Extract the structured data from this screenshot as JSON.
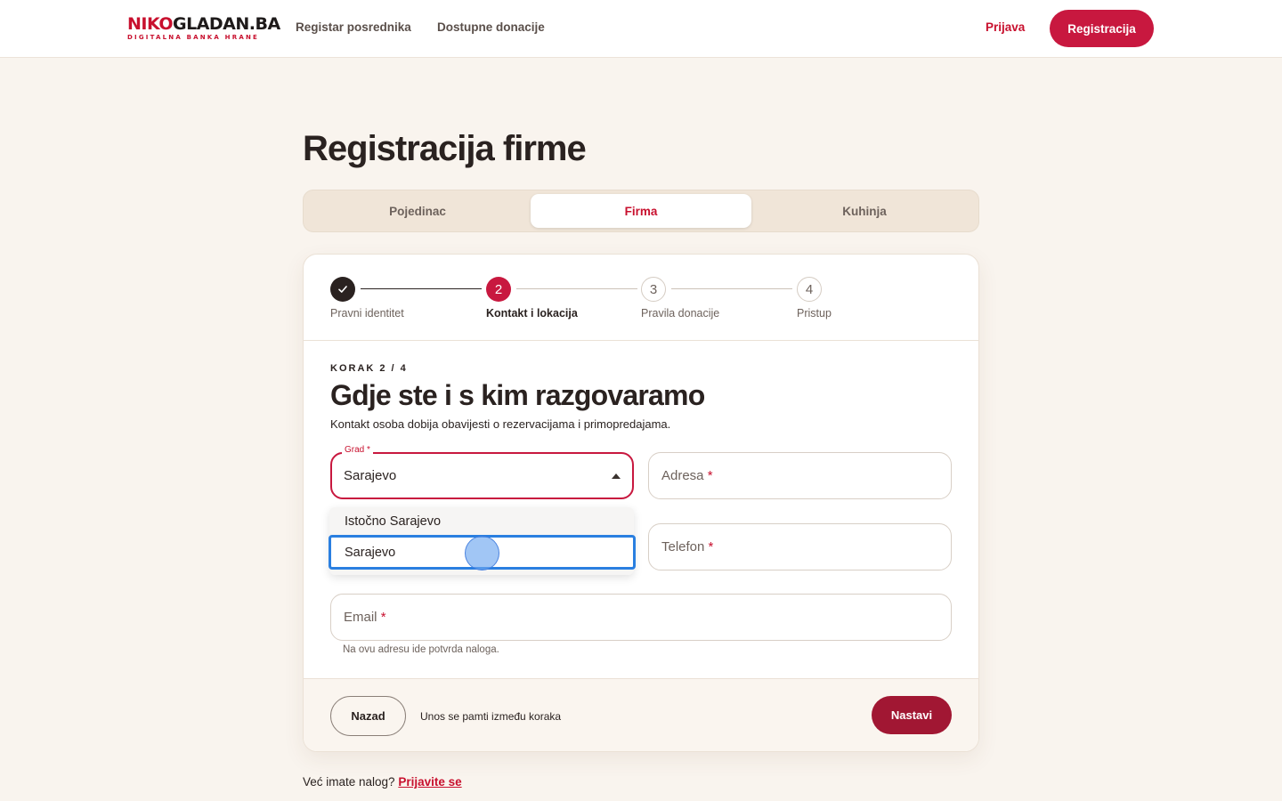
{
  "header": {
    "logo_part1": "NIKO",
    "logo_part2": "GLADAN.BA",
    "logo_tagline": "DIGITALNA BANKA HRANE",
    "nav": [
      "Registar posrednika",
      "Dostupne donacije"
    ],
    "login_label": "Prijava",
    "register_label": "Registracija"
  },
  "page": {
    "title": "Registracija firme",
    "tabs": [
      {
        "label": "Pojedinac",
        "active": false
      },
      {
        "label": "Firma",
        "active": true
      },
      {
        "label": "Kuhinja",
        "active": false
      }
    ]
  },
  "stepper": {
    "steps": [
      {
        "number": "1",
        "label": "Pravni identitet",
        "state": "done"
      },
      {
        "number": "2",
        "label": "Kontakt i lokacija",
        "state": "current"
      },
      {
        "number": "3",
        "label": "Pravila donacije",
        "state": "todo"
      },
      {
        "number": "4",
        "label": "Pristup",
        "state": "todo"
      }
    ]
  },
  "form": {
    "eyebrow": "KORAK 2 / 4",
    "title": "Gdje ste i s kim razgovaramo",
    "description": "Kontakt osoba dobija obavijesti o rezervacijama i primopredajama.",
    "city": {
      "label": "Grad",
      "required_mark": "*",
      "value": "Sarajevo"
    },
    "address": {
      "label": "Adresa",
      "required_mark": "*"
    },
    "phone": {
      "label": "Telefon",
      "required_mark": "*"
    },
    "email": {
      "label": "Email",
      "required_mark": "*",
      "hint": "Na ovu adresu ide potvrda naloga."
    },
    "city_options": [
      "Istočno Sarajevo",
      "Sarajevo"
    ],
    "city_highlighted": "Sarajevo"
  },
  "footer": {
    "back_label": "Nazad",
    "note": "Unos se pamti između koraka",
    "next_label": "Nastavi"
  },
  "bottom": {
    "question": "Već imate nalog?",
    "link": "Prijavite se"
  },
  "colors": {
    "brand_red": "#c8183f",
    "dark_red": "#a11733",
    "background": "#f9f4ee",
    "focus_blue": "#2a7fe0"
  }
}
